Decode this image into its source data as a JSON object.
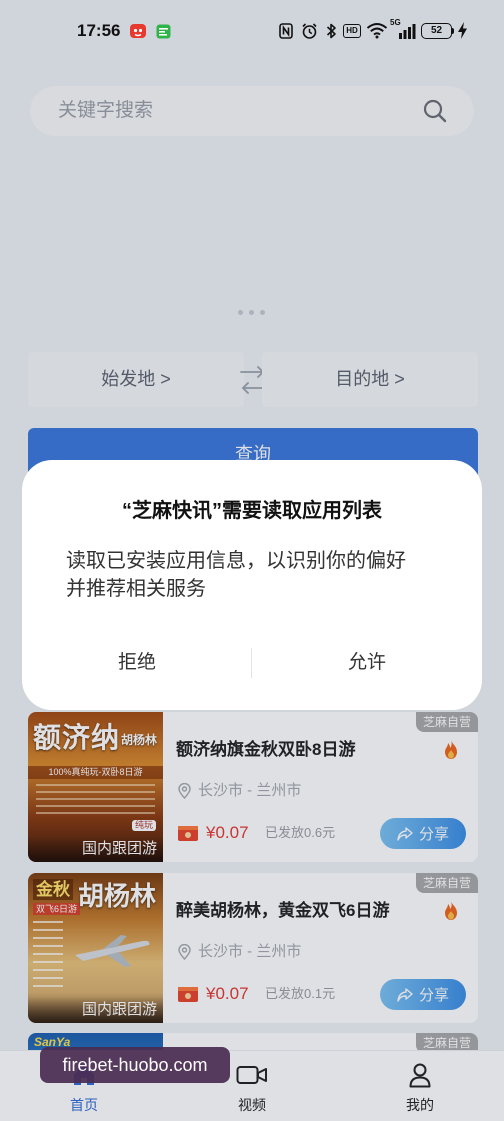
{
  "status_bar": {
    "time": "17:56",
    "hd": "HD",
    "network": "5G",
    "battery": "52",
    "icons": [
      "app-notification-icon",
      "message-icon",
      "nfc-icon",
      "alarm-icon",
      "bluetooth-icon",
      "hd-icon",
      "wifi-icon",
      "signal-icon",
      "battery-icon",
      "charging-icon"
    ]
  },
  "search": {
    "placeholder": "关键字搜索",
    "icon": "search-icon"
  },
  "route": {
    "origin": "始发地 >",
    "destination": "目的地 >",
    "swap_icon": "swap-icon"
  },
  "query_button": {
    "label": "查询"
  },
  "dialog": {
    "title": "“芝麻快讯”需要读取应用列表",
    "body_lines": [
      "读取已安装应用信息，以识别你的偏好",
      "并推荐相关服务"
    ],
    "deny_label": "拒绝",
    "allow_label": "允许"
  },
  "products": [
    {
      "badge": "芝麻自营",
      "title": "额济纳旗金秋双卧8日游",
      "route": "长沙市 - 兰州市",
      "price": "¥0.07",
      "issued": "已发放0.6元",
      "share_label": "分享",
      "category": "国内跟团游",
      "hot_icon": "fire-icon",
      "poster": {
        "headline": "额济纳",
        "subhead": "胡杨林",
        "tagline": "100%真纯玩-双卧8日游",
        "stamp": "纯玩"
      }
    },
    {
      "badge": "芝麻自营",
      "title": "醉美胡杨林，黄金双飞6日游",
      "route": "长沙市 - 兰州市",
      "price": "¥0.07",
      "issued": "已发放0.1元",
      "share_label": "分享",
      "category": "国内跟团游",
      "hot_icon": "fire-icon",
      "poster": {
        "season": "金秋",
        "tagline": "双飞6日游",
        "headline": "胡杨林"
      }
    },
    {
      "badge": "芝麻自营",
      "poster": {
        "headline": "SanYa"
      }
    }
  ],
  "nav": [
    {
      "label": "首页",
      "icon": "home-icon",
      "active": true
    },
    {
      "label": "视频",
      "icon": "video-icon",
      "active": false
    },
    {
      "label": "我的",
      "icon": "profile-icon",
      "active": false
    }
  ],
  "watermark": "firebet-huobo.com",
  "colors": {
    "primary": "#3b78de",
    "price": "#e53935",
    "badge": "#a9a9a9",
    "share_start": "#7cc3f3",
    "share_end": "#3b8fe6",
    "nav_active": "#2f6bd8",
    "watermark_bg": "#4b2d52",
    "hot": "#f2661c"
  }
}
